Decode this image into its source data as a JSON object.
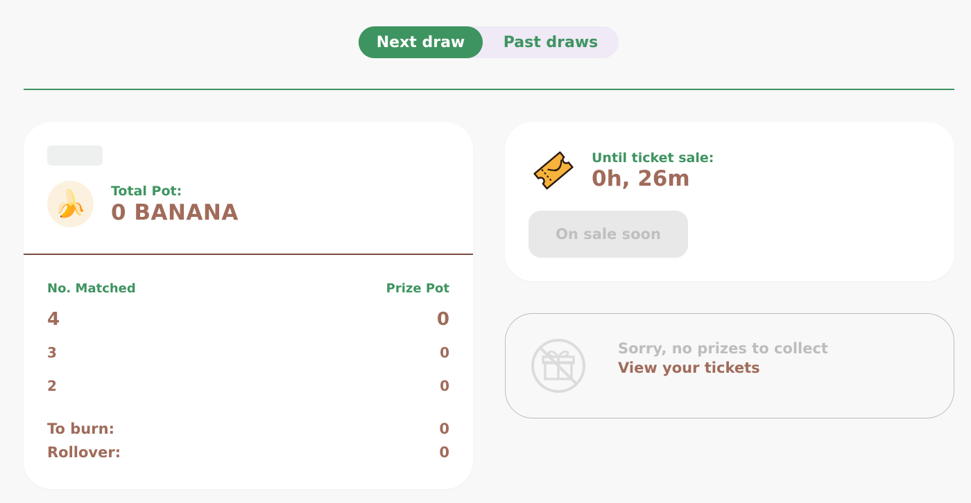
{
  "tabs": {
    "next_draw": "Next draw",
    "past_draws": "Past draws"
  },
  "pot_card": {
    "total_pot_label": "Total Pot:",
    "total_pot_value": "0 BANANA",
    "col_matched": "No. Matched",
    "col_prize": "Prize Pot",
    "rows": [
      {
        "matched": "4",
        "prize": "0"
      },
      {
        "matched": "3",
        "prize": "0"
      },
      {
        "matched": "2",
        "prize": "0"
      }
    ],
    "to_burn_label": "To burn:",
    "to_burn_value": "0",
    "rollover_label": "Rollover:",
    "rollover_value": "0"
  },
  "sale_card": {
    "label": "Until ticket sale:",
    "time": "0h, 26m",
    "button": "On sale soon"
  },
  "prize_card": {
    "message": "Sorry, no prizes to collect",
    "link": "View your tickets"
  },
  "colors": {
    "accent_green": "#3e9460",
    "brown": "#a06b5a",
    "toggle_bg": "#efeaf6",
    "muted_gray": "#bdbdbd"
  },
  "icons": {
    "pot": "banana-icon",
    "sale": "ticket-icon",
    "prize": "gift-no-icon"
  }
}
